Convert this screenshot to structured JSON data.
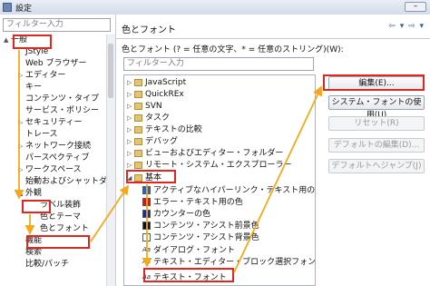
{
  "window": {
    "title": "設定"
  },
  "left": {
    "filter_placeholder": "フィルター入力",
    "tree": [
      {
        "label": "一般",
        "twisty": "▲"
      },
      {
        "label": "JStyle",
        "twisty": ""
      },
      {
        "label": "Web ブラウザー",
        "twisty": ""
      },
      {
        "label": "エディター",
        "twisty": "▷"
      },
      {
        "label": "キー",
        "twisty": ""
      },
      {
        "label": "コンテンツ・タイプ",
        "twisty": ""
      },
      {
        "label": "サービス・ポリシー",
        "twisty": ""
      },
      {
        "label": "セキュリティー",
        "twisty": "▷"
      },
      {
        "label": "トレース",
        "twisty": ""
      },
      {
        "label": "ネットワーク接続",
        "twisty": "▷"
      },
      {
        "label": "パースペクティブ",
        "twisty": ""
      },
      {
        "label": "ワークスペース",
        "twisty": "▷"
      },
      {
        "label": "始動およびシャットダ",
        "twisty": ""
      },
      {
        "label": "外観",
        "twisty": "▲"
      },
      {
        "label": "ラベル装飾",
        "twisty": ""
      },
      {
        "label": "色とテーマ",
        "twisty": ""
      },
      {
        "label": "色とフォント",
        "twisty": ""
      },
      {
        "label": "機能",
        "twisty": ""
      },
      {
        "label": "検索",
        "twisty": ""
      },
      {
        "label": "比較/パッチ",
        "twisty": ""
      }
    ]
  },
  "right": {
    "header": "色とフォント",
    "nav_arrows": "⇦ ▾ ⇨ ▾",
    "description": "色とフォント (? = 任意の文字、* = 任意のストリング)(W):",
    "filter_placeholder": "フィルター入力",
    "tree": [
      {
        "label": "JavaScript",
        "kind": "folder"
      },
      {
        "label": "QuickREx",
        "kind": "folder"
      },
      {
        "label": "SVN",
        "kind": "folder"
      },
      {
        "label": "タスク",
        "kind": "folder"
      },
      {
        "label": "テキストの比較",
        "kind": "folder"
      },
      {
        "label": "デバッグ",
        "kind": "folder"
      },
      {
        "label": "ビューおよびエディター・フォルダー",
        "kind": "folder"
      },
      {
        "label": "リモート・システム・エクスプローラー",
        "kind": "folder"
      },
      {
        "label": "基本",
        "kind": "folder-open"
      },
      {
        "label": "アクティブなハイパーリンク・テキスト用の色",
        "kind": "color",
        "color": "#2a63c8"
      },
      {
        "label": "エラー・テキスト用の色",
        "kind": "color",
        "color": "#d11a1a"
      },
      {
        "label": "カウンターの色",
        "kind": "color",
        "color": "#1a2f8c"
      },
      {
        "label": "コンテンツ・アシスト前景色",
        "kind": "color",
        "color": "#111111"
      },
      {
        "label": "コンテンツ・アシスト背景色",
        "kind": "color",
        "color": "#ffffff"
      },
      {
        "label": "ダイアログ・フォント",
        "kind": "font"
      },
      {
        "label": "テキスト・エディター・ブロック選択フォント",
        "kind": "font"
      },
      {
        "label": "テキスト・フォント",
        "kind": "font"
      }
    ],
    "buttons": {
      "edit": "編集(E)...",
      "use_system_font": "システム・フォントの使用(U)",
      "reset": "リセット(R)",
      "edit_default": "デフォルトの編集(D)...",
      "jump_default": "デフォルトへジャンプ(J)"
    }
  },
  "colors": {
    "highlight_box": "#e0261e",
    "arrow": "#f5a81c"
  }
}
